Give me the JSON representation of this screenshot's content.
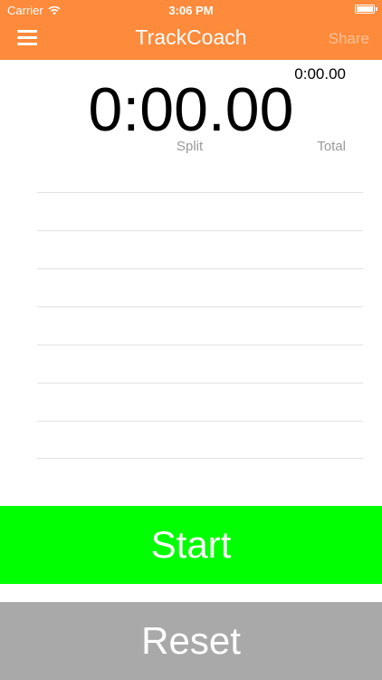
{
  "status_bar": {
    "carrier": "Carrier",
    "time": "3:06 PM",
    "wifi_icon": "wifi-icon",
    "battery_icon": "battery-icon"
  },
  "nav": {
    "menu_icon": "hamburger-menu-icon",
    "title": "TrackCoach",
    "share_label": "Share"
  },
  "timer": {
    "total_time": "0:00.00",
    "split_time": "0:00.00",
    "split_label": "Split",
    "total_label": "Total"
  },
  "laps": {
    "rows": [
      "",
      "",
      "",
      "",
      "",
      "",
      ""
    ]
  },
  "controls": {
    "start_label": "Start",
    "reset_label": "Reset"
  },
  "colors": {
    "header": "#fe8a3c",
    "start": "#00ff00",
    "reset": "#a9a9a9",
    "share_disabled": "#ffc196",
    "label_gray": "#9a9a9a"
  }
}
